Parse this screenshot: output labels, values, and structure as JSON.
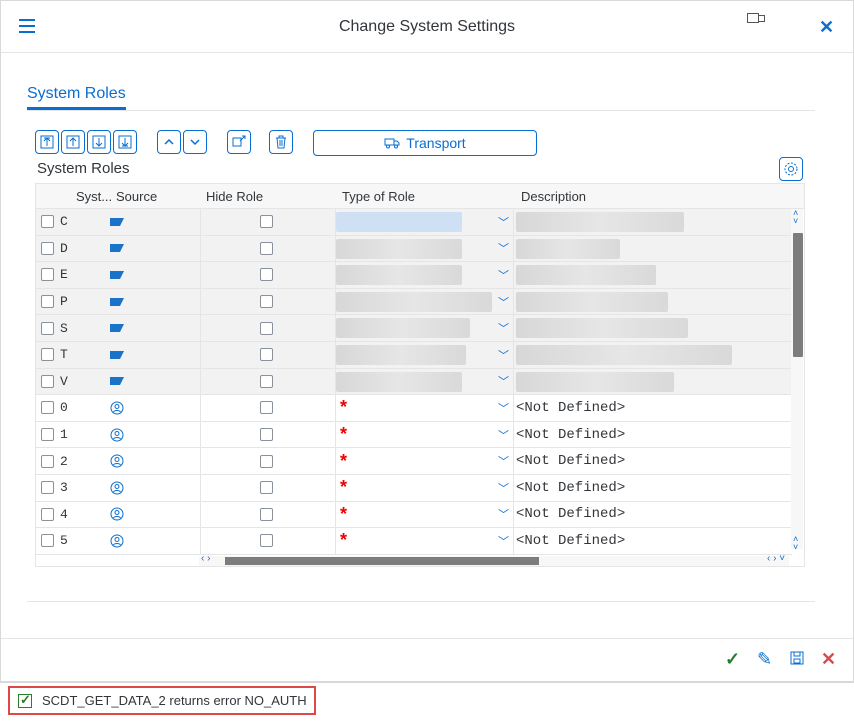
{
  "window": {
    "title": "Change System Settings"
  },
  "tabs": [
    {
      "label": "System Roles"
    }
  ],
  "toolbar": {
    "transport_label": "Transport"
  },
  "table": {
    "title": "System Roles",
    "columns": [
      "Syst...",
      "Source",
      "Hide Role",
      "Type of Role",
      "Description"
    ],
    "rows": [
      {
        "system": "C",
        "source": "sap-logo",
        "hidden_values": true
      },
      {
        "system": "D",
        "source": "sap-logo",
        "hidden_values": true
      },
      {
        "system": "E",
        "source": "sap-logo",
        "hidden_values": true
      },
      {
        "system": "P",
        "source": "sap-logo",
        "hidden_values": true
      },
      {
        "system": "S",
        "source": "sap-logo",
        "hidden_values": true
      },
      {
        "system": "T",
        "source": "sap-logo",
        "hidden_values": true
      },
      {
        "system": "V",
        "source": "sap-logo",
        "hidden_values": true
      },
      {
        "system": "0",
        "source": "user-icon",
        "type": "*",
        "description": "<Not Defined>"
      },
      {
        "system": "1",
        "source": "user-icon",
        "type": "*",
        "description": "<Not Defined>"
      },
      {
        "system": "2",
        "source": "user-icon",
        "type": "*",
        "description": "<Not Defined>"
      },
      {
        "system": "3",
        "source": "user-icon",
        "type": "*",
        "description": "<Not Defined>"
      },
      {
        "system": "4",
        "source": "user-icon",
        "type": "*",
        "description": "<Not Defined>"
      },
      {
        "system": "5",
        "source": "user-icon",
        "type": "*",
        "description": "<Not Defined>"
      }
    ]
  },
  "status": {
    "message": "SCDT_GET_DATA_2 returns error NO_AUTH"
  },
  "colors": {
    "accent": "#0a6ed1",
    "error": "#e04848",
    "ok": "#2b7c2b"
  }
}
